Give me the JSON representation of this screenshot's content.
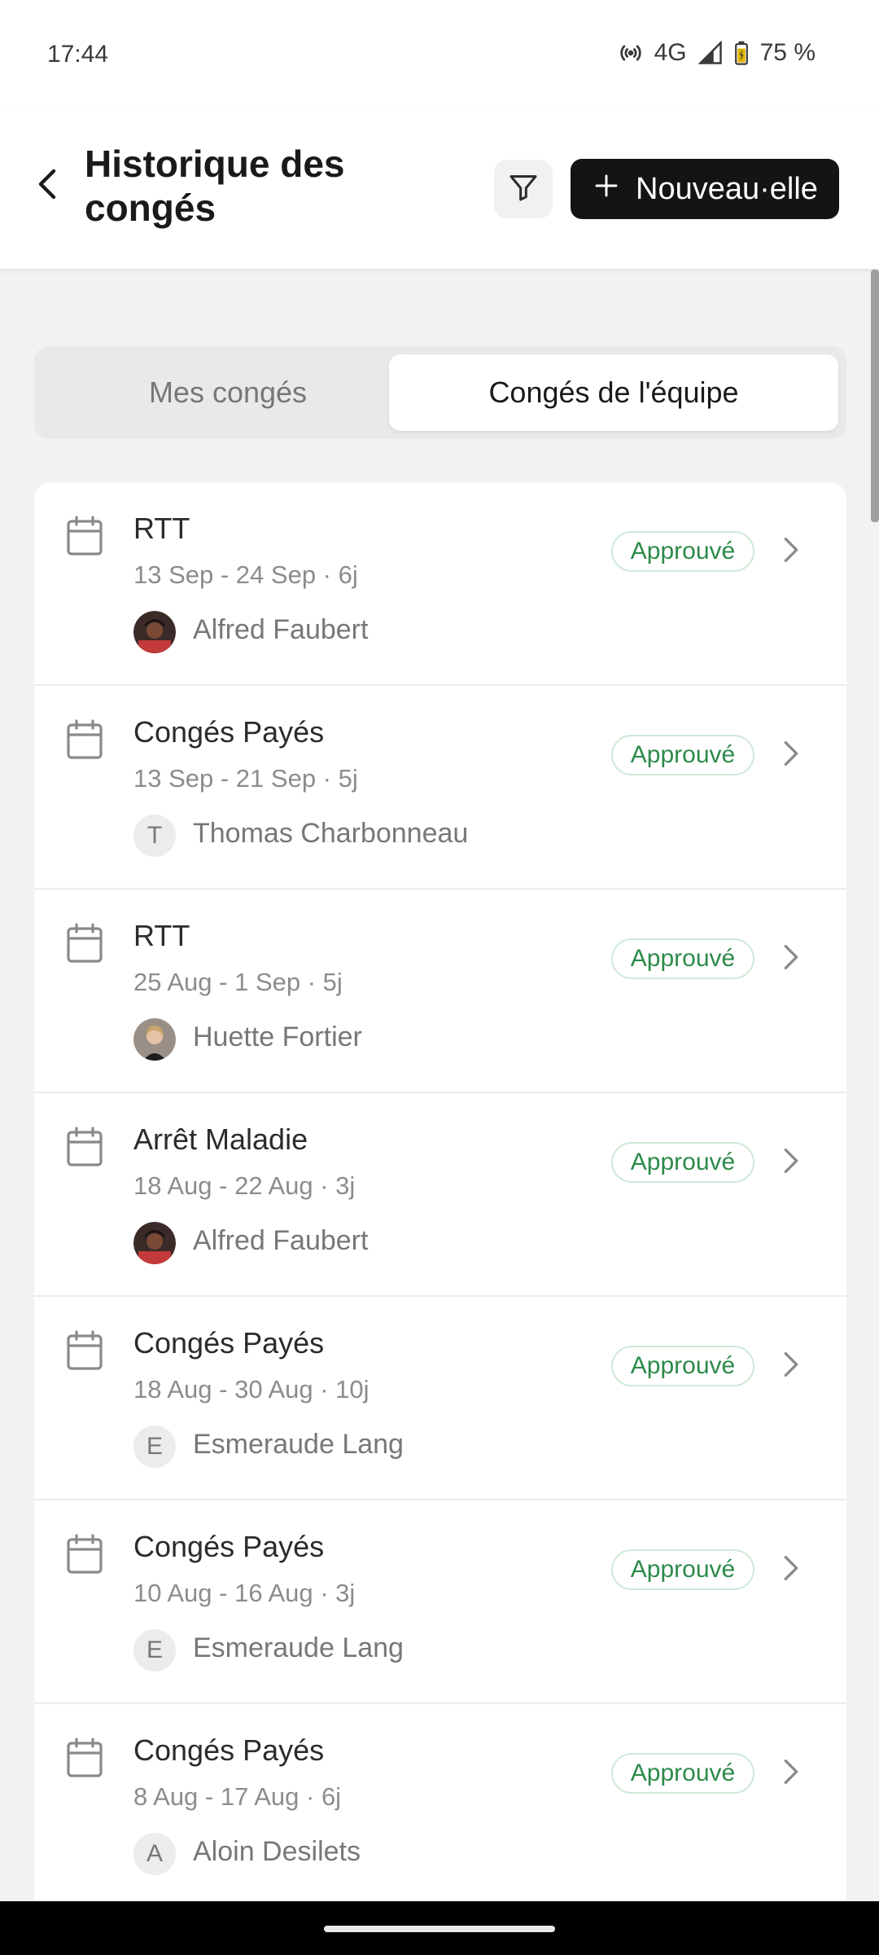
{
  "status_bar": {
    "time": "17:44",
    "network": "4G",
    "battery": "75 %",
    "icons": [
      "hotspot-icon",
      "signal-icon",
      "battery-icon"
    ]
  },
  "header": {
    "back_icon": "chevron-left-icon",
    "title": "Historique des congés",
    "filter_icon": "filter-icon",
    "new_button_label": "Nouveau·elle",
    "new_button_icon": "plus-icon"
  },
  "tabs": {
    "mine": "Mes congés",
    "team": "Congés de l'équipe",
    "selected": "team"
  },
  "leaves": [
    {
      "type": "RTT",
      "dates": "13 Sep - 24 Sep · 6j",
      "person": "Alfred Faubert",
      "initial": "",
      "status": "Approuvé"
    },
    {
      "type": "Congés Payés",
      "dates": "13 Sep - 21 Sep · 5j",
      "person": "Thomas Charbonneau",
      "initial": "T",
      "status": "Approuvé"
    },
    {
      "type": "RTT",
      "dates": "25 Aug - 1 Sep · 5j",
      "person": "Huette Fortier",
      "initial": "",
      "status": "Approuvé"
    },
    {
      "type": "Arrêt Maladie",
      "dates": "18 Aug - 22 Aug · 3j",
      "person": "Alfred Faubert",
      "initial": "",
      "status": "Approuvé"
    },
    {
      "type": "Congés Payés",
      "dates": "18 Aug - 30 Aug · 10j",
      "person": "Esmeraude Lang",
      "initial": "E",
      "status": "Approuvé"
    },
    {
      "type": "Congés Payés",
      "dates": "10 Aug - 16 Aug · 3j",
      "person": "Esmeraude Lang",
      "initial": "E",
      "status": "Approuvé"
    },
    {
      "type": "Congés Payés",
      "dates": "8 Aug - 17 Aug · 6j",
      "person": "Aloin Desilets",
      "initial": "A",
      "status": "Approuvé"
    }
  ],
  "colors": {
    "accent_dark": "#141414",
    "approved_text": "#2c8a4a",
    "approved_border": "#cde9d5",
    "background": "#f2f2f2"
  }
}
